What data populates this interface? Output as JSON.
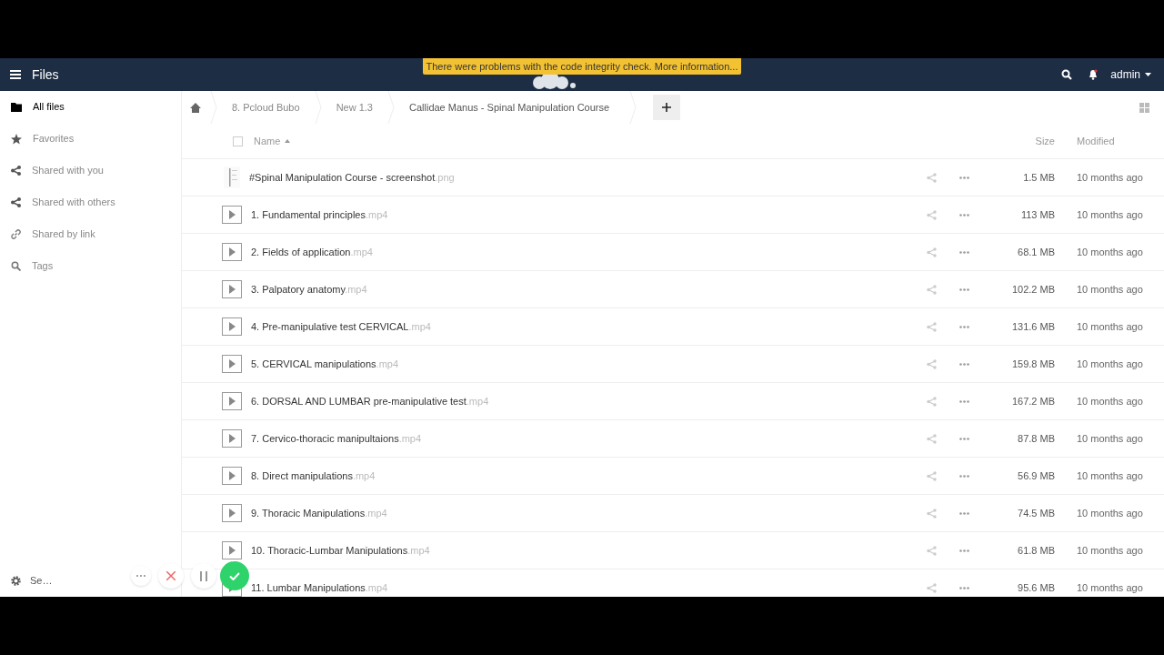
{
  "header": {
    "app_title": "Files",
    "notice": "There were problems with the code integrity check. More information...",
    "user": "admin"
  },
  "sidebar": {
    "items": [
      {
        "label": "All files",
        "selected": true
      },
      {
        "label": "Favorites",
        "selected": false
      },
      {
        "label": "Shared with you",
        "selected": false
      },
      {
        "label": "Shared with others",
        "selected": false
      },
      {
        "label": "Shared by link",
        "selected": false
      },
      {
        "label": "Tags",
        "selected": false
      }
    ],
    "settings": "Se…"
  },
  "breadcrumbs": [
    "8. Pcloud Bubo",
    "New 1.3",
    "Callidae Manus - Spinal Manipulation Course"
  ],
  "table": {
    "select_all_checked": false,
    "columns": [
      "Name",
      "Size",
      "Modified"
    ],
    "rows": [
      {
        "kind": "image",
        "name": "#Spinal Manipulation Course - screenshot.png",
        "size": "1.5 MB",
        "modified": "10 months ago"
      },
      {
        "kind": "video",
        "name": "1. Fundamental principles.mp4",
        "size": "113 MB",
        "modified": "10 months ago"
      },
      {
        "kind": "video",
        "name": "2. Fields of application.mp4",
        "size": "68.1 MB",
        "modified": "10 months ago"
      },
      {
        "kind": "video",
        "name": "3. Palpatory anatomy.mp4",
        "size": "102.2 MB",
        "modified": "10 months ago"
      },
      {
        "kind": "video",
        "name": "4. Pre-manipulative test CERVICAL.mp4",
        "size": "131.6 MB",
        "modified": "10 months ago"
      },
      {
        "kind": "video",
        "name": "5. CERVICAL manipulations.mp4",
        "size": "159.8 MB",
        "modified": "10 months ago"
      },
      {
        "kind": "video",
        "name": "6. DORSAL AND LUMBAR pre-manipulative test.mp4",
        "size": "167.2 MB",
        "modified": "10 months ago"
      },
      {
        "kind": "video",
        "name": "7. Cervico-thoracic manipultaions.mp4",
        "size": "87.8 MB",
        "modified": "10 months ago"
      },
      {
        "kind": "video",
        "name": "8. Direct manipulations.mp4",
        "size": "56.9 MB",
        "modified": "10 months ago"
      },
      {
        "kind": "video",
        "name": "9. Thoracic Manipulations.mp4",
        "size": "74.5 MB",
        "modified": "10 months ago"
      },
      {
        "kind": "video",
        "name": "10. Thoracic-Lumbar Manipulations.mp4",
        "size": "61.8 MB",
        "modified": "10 months ago"
      },
      {
        "kind": "video",
        "name": "11. Lumbar Manipulations.mp4",
        "size": "95.6 MB",
        "modified": "10 months ago"
      }
    ]
  }
}
